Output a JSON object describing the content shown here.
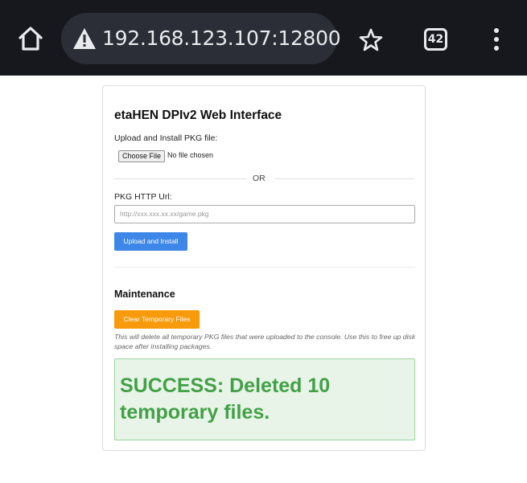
{
  "browser": {
    "url": "192.168.123.107:12800",
    "tab_count": "42",
    "icons": [
      "home-icon",
      "warning-icon",
      "star-icon",
      "tabs-icon",
      "more-vert-icon"
    ],
    "bar_color": "#16181d"
  },
  "page": {
    "title": "etaHEN DPIv2 Web Interface",
    "upload_label": "Upload and Install PKG file:",
    "choose_file_label": "Choose File",
    "no_file_text": "No file chosen",
    "or_text": "OR",
    "pkg_url_label": "PKG HTTP Url:",
    "pkg_url_placeholder": "http://xxx.xxx.xx.xx/game.pkg",
    "upload_button": "Upload and Install",
    "maintenance_title": "Maintenance",
    "clear_button": "Clear Temporary Files",
    "maintenance_note": "This will delete all temporary PKG files that were uploaded to the console. Use this to free up disk space after installing packages.",
    "success_message": "SUCCESS: Deleted 10 temporary files.",
    "colors": {
      "primary_button": "#3d87e8",
      "warning_button": "#f79a0b",
      "success_text": "#43a047",
      "success_bg": "#e7f4e7"
    }
  }
}
